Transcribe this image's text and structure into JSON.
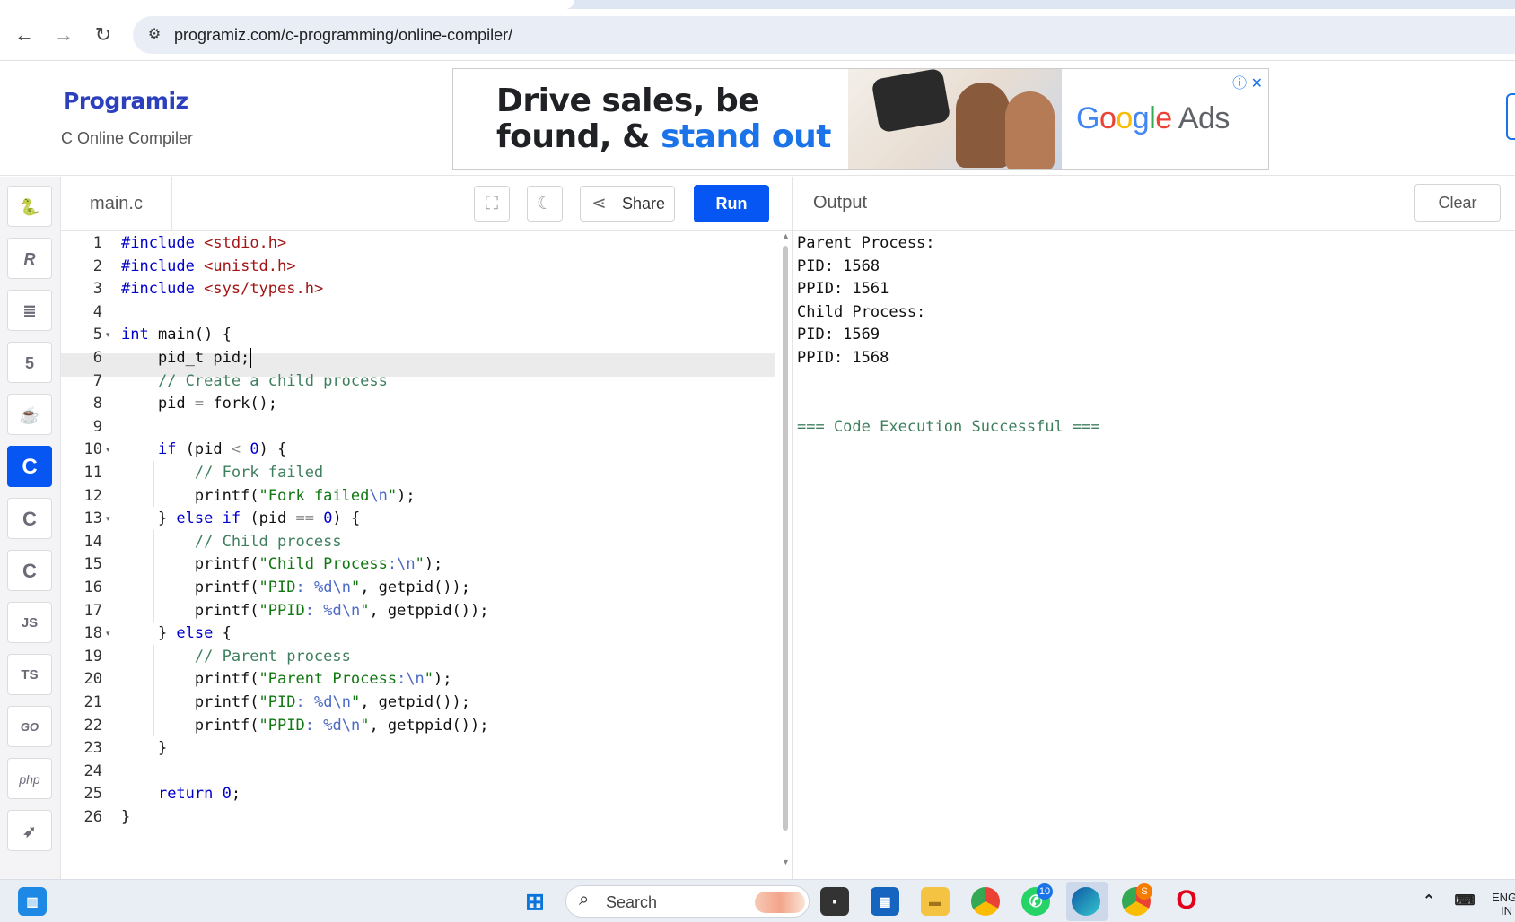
{
  "browser": {
    "url_domain": "programiz.com",
    "url_path": "/c-programming/online-compiler/"
  },
  "site": {
    "logo": "Programiz",
    "subtitle": "C Online Compiler"
  },
  "ad": {
    "headline_line1": "Drive sales, be",
    "headline_line2_a": "found, & ",
    "headline_line2_b": "stand out",
    "brand_google": [
      "G",
      "o",
      "o",
      "g",
      "l",
      "e"
    ],
    "brand_ads": "Ads"
  },
  "languages": [
    {
      "name": "python",
      "glyph": "🐍",
      "active": false
    },
    {
      "name": "r",
      "glyph": "R",
      "active": false
    },
    {
      "name": "sql",
      "glyph": "≣",
      "active": false
    },
    {
      "name": "html",
      "glyph": "5",
      "active": false
    },
    {
      "name": "java",
      "glyph": "☕",
      "active": false
    },
    {
      "name": "c",
      "glyph": "C",
      "active": true
    },
    {
      "name": "cpp",
      "glyph": "C",
      "active": false
    },
    {
      "name": "csharp",
      "glyph": "C",
      "active": false
    },
    {
      "name": "javascript",
      "glyph": "JS",
      "active": false
    },
    {
      "name": "typescript",
      "glyph": "TS",
      "active": false
    },
    {
      "name": "go",
      "glyph": "GO",
      "active": false
    },
    {
      "name": "php",
      "glyph": "php",
      "active": false
    },
    {
      "name": "swift",
      "glyph": "➶",
      "active": false
    }
  ],
  "editor": {
    "file_name": "main.c",
    "share_label": "Share",
    "run_label": "Run",
    "line_numbers": [
      "1",
      "2",
      "3",
      "4",
      "5",
      "6",
      "7",
      "8",
      "9",
      "10",
      "11",
      "12",
      "13",
      "14",
      "15",
      "16",
      "17",
      "18",
      "19",
      "20",
      "21",
      "22",
      "23",
      "24",
      "25",
      "26"
    ],
    "fold_lines": [
      5,
      10,
      13,
      18
    ],
    "active_line": 6,
    "code": [
      "#include <stdio.h>",
      "#include <unistd.h>",
      "#include <sys/types.h>",
      "",
      "int main() {",
      "    pid_t pid;",
      "    // Create a child process",
      "    pid = fork();",
      "",
      "    if (pid < 0) {",
      "        // Fork failed",
      "        printf(\"Fork failed\\n\");",
      "    } else if (pid == 0) {",
      "        // Child process",
      "        printf(\"Child Process:\\n\");",
      "        printf(\"PID: %d\\n\", getpid());",
      "        printf(\"PPID: %d\\n\", getppid());",
      "    } else {",
      "        // Parent process",
      "        printf(\"Parent Process:\\n\");",
      "        printf(\"PID: %d\\n\", getpid());",
      "        printf(\"PPID: %d\\n\", getppid());",
      "    }",
      "",
      "    return 0;",
      "}"
    ]
  },
  "output": {
    "title": "Output",
    "clear_label": "Clear",
    "lines": [
      "Parent Process:",
      "PID: 1568",
      "PPID: 1561",
      "Child Process:",
      "PID: 1569",
      "PPID: 1568",
      "",
      "",
      "=== Code Execution Successful ==="
    ]
  },
  "taskbar": {
    "search_label": "Search",
    "whatsapp_badge": "10",
    "chrome_badge": "S",
    "tray_lang_line1": "ENG",
    "tray_lang_line2": "IN"
  }
}
